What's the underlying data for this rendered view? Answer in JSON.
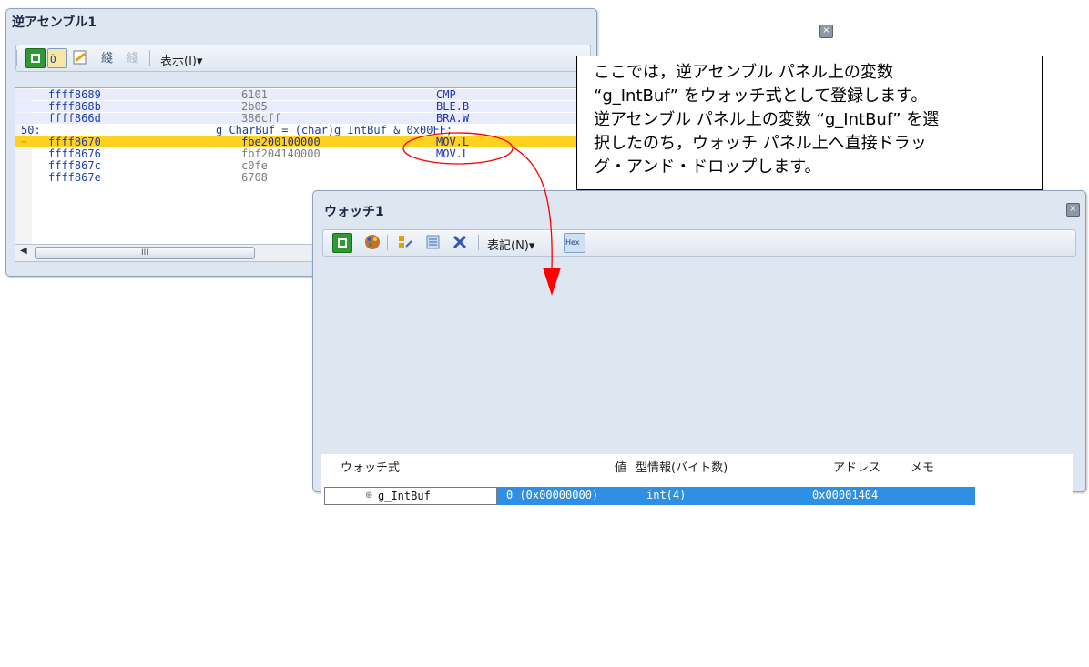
{
  "disassembly": {
    "title": "逆アセンブル1",
    "close_glyph": "×",
    "view_menu_label": "表示(I)▾",
    "rows": [
      {
        "addr": "ffff8689",
        "code": "6101",
        "mnem": "CMP"
      },
      {
        "addr": "ffff868b",
        "code": "2b05",
        "mnem": "BLE.B"
      },
      {
        "addr": "ffff866d",
        "code": "386cff",
        "mnem": "BRA.W"
      },
      {
        "line_no": "50:",
        "source": "g_CharBuf = (char)g_IntBuf & 0x00FF;"
      },
      {
        "addr": "ffff8670",
        "code": "fbe200100000",
        "mnem": "MOV.L"
      },
      {
        "addr": "ffff8676",
        "code": "fbf204140000",
        "mnem": "MOV.L"
      },
      {
        "addr": "ffff867c",
        "code": "c0fe",
        "mnem": ""
      },
      {
        "addr": "ffff867e",
        "code": "6708",
        "mnem": ""
      }
    ],
    "scroll_thumb_label": "III"
  },
  "watch": {
    "title": "ウォッチ1",
    "close_glyph": "×",
    "notation_menu_label": "表記(N)▾",
    "hex_button_label": "Hex",
    "columns": {
      "expression": "ウォッチ式",
      "value": "値",
      "type": "型情報(バイト数)",
      "address": "アドレス",
      "memo": "メモ"
    },
    "rows": [
      {
        "expression": "g_IntBuf",
        "value": "0 (0x00000000)",
        "type": "int(4)",
        "address": "0x00001404"
      }
    ]
  },
  "callout": {
    "lines": [
      "ここでは，逆アセンブル パネル上の変数",
      "“g_IntBuf” をウォッチ式として登録します。",
      "逆アセンブル パネル上の変数 “g_IntBuf” を選",
      "択したのち，ウォッチ パネル上へ直接ドラッ",
      "グ・アンド・ドロップします。"
    ]
  },
  "colors": {
    "current_line": "#ffd21f",
    "selected_row": "#2f8fe4",
    "arrow": "#ff0000",
    "window_frame": "#dde6f1"
  }
}
